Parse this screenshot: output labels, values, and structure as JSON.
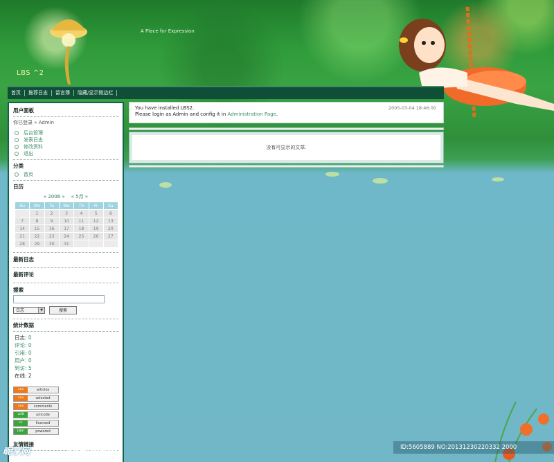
{
  "header": {
    "site_name": "LBS ^2",
    "tagline": "A Place for Expression"
  },
  "nav": {
    "items": [
      "首页",
      "推荐日志",
      "留言簿",
      "隐藏/显示侧边栏"
    ]
  },
  "sidebar": {
    "user_panel": {
      "title": "用户面板",
      "logged_in_text": "你已登录 » Admin",
      "links": [
        "后台管理",
        "发表日志",
        "修改资料",
        "退出"
      ]
    },
    "category": {
      "title": "分类",
      "items": [
        "首页"
      ]
    },
    "calendar": {
      "title": "日历",
      "year_label": "« 2006 »",
      "month_label": "« 5月 »",
      "weekdays": [
        "Su",
        "Mo",
        "Tu",
        "We",
        "Th",
        "Fr",
        "Sa"
      ],
      "weeks": [
        [
          "",
          "1",
          "2",
          "3",
          "4",
          "5",
          "6"
        ],
        [
          "7",
          "8",
          "9",
          "10",
          "11",
          "12",
          "13"
        ],
        [
          "14",
          "15",
          "16",
          "17",
          "18",
          "19",
          "20"
        ],
        [
          "21",
          "22",
          "23",
          "24",
          "25",
          "26",
          "27"
        ],
        [
          "28",
          "29",
          "30",
          "31",
          "",
          "",
          ""
        ]
      ]
    },
    "latest_posts": {
      "title": "最新日志"
    },
    "latest_comments": {
      "title": "最新评论"
    },
    "search": {
      "title": "搜索",
      "select_value": "日志",
      "button_label": "搜索"
    },
    "stats": {
      "title": "统计数据",
      "lines": [
        {
          "key": "日志: ",
          "value": "0"
        },
        {
          "key": "评论: ",
          "value": "0"
        },
        {
          "key": "引用: ",
          "value": "0"
        },
        {
          "key": "用户: ",
          "value": "0"
        },
        {
          "key": "到访: ",
          "value": "5"
        },
        {
          "key": "在线: ",
          "value": "2"
        }
      ]
    },
    "badges": [
      {
        "left": "xxx",
        "right": "articles",
        "color": "#f07a1a"
      },
      {
        "left": "xxx",
        "right": "selected",
        "color": "#f07a1a"
      },
      {
        "left": "xxx",
        "right": "comments",
        "color": "#f07a1a"
      },
      {
        "left": "utf8",
        "right": "unicode",
        "color": "#3aa63a"
      },
      {
        "left": "cc",
        "right": "licensed",
        "color": "#3aa63a"
      },
      {
        "left": "LBS²",
        "right": "powered",
        "color": "#3aa63a"
      }
    ],
    "friend_links": {
      "title": "友情链接"
    }
  },
  "notice": {
    "line1": "You have installed LBS2.",
    "line2_prefix": "Please login as Admin and config it in ",
    "line2_link": "Administration Page",
    "line2_suffix": ".",
    "timestamp": "2005-03-04 18:46:00"
  },
  "content": {
    "empty_message": "没有可显示的文章."
  },
  "watermark": {
    "logo": "昵享网",
    "url": "www.nipic.cn",
    "id_text": "ID:5605889 NO:20131230220332 2000"
  }
}
